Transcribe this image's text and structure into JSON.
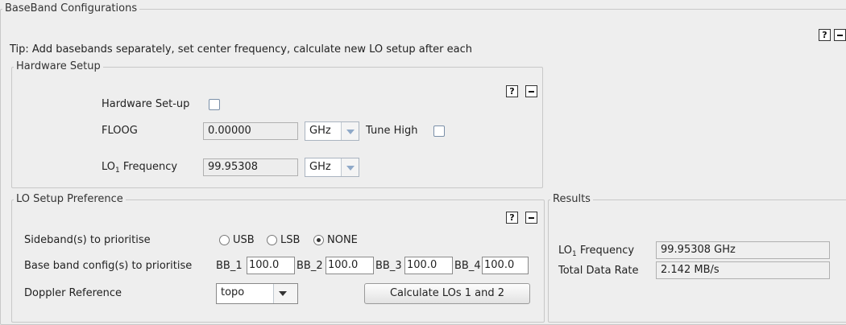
{
  "baseband": {
    "title": "BaseBand Configurations",
    "tip": "Tip: Add basebands separately, set center frequency, calculate new LO setup after each",
    "help": "?"
  },
  "hardware": {
    "title": "Hardware Setup",
    "help": "?",
    "setup_label": "Hardware Set-up",
    "floog_label": "FLOOG",
    "floog_value": "0.00000",
    "floog_unit": "GHz",
    "tune_high_label": "Tune High",
    "lo1_label_main": "LO",
    "lo1_label_sub": "1",
    "lo1_label_rest": " Frequency",
    "lo1_value": "99.95308",
    "lo1_unit": "GHz"
  },
  "lo_setup": {
    "title": "LO Setup Preference",
    "help": "?",
    "sideband_label": "Sideband(s) to prioritise",
    "sideband_options": [
      "USB",
      "LSB",
      "NONE"
    ],
    "sideband_selected": "NONE",
    "bb_label": "Base band config(s) to prioritise",
    "bb": [
      {
        "label": "BB_1",
        "value": "100.0"
      },
      {
        "label": "BB_2",
        "value": "100.0"
      },
      {
        "label": "BB_3",
        "value": "100.0"
      },
      {
        "label": "BB_4",
        "value": "100.0"
      }
    ],
    "doppler_label": "Doppler Reference",
    "doppler_value": "topo",
    "calc_button": "Calculate LOs 1 and 2"
  },
  "results": {
    "title": "Results",
    "lo1_label_main": "LO",
    "lo1_label_sub": "1",
    "lo1_label_rest": " Frequency",
    "lo1_value": "99.95308 GHz",
    "rate_label": "Total Data Rate",
    "rate_value": "2.142 MB/s"
  }
}
